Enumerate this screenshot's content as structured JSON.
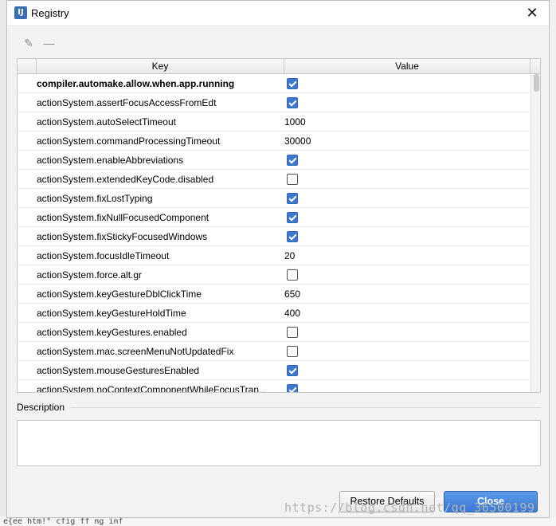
{
  "window": {
    "title": "Registry",
    "app_icon": "IJ"
  },
  "toolbar": {
    "edit_icon": "edit-icon",
    "remove_icon": "minus-icon"
  },
  "table": {
    "headers": {
      "key": "Key",
      "value": "Value"
    },
    "rows": [
      {
        "key": "compiler.automake.allow.when.app.running",
        "type": "bool",
        "checked": true,
        "bold": true
      },
      {
        "key": "actionSystem.assertFocusAccessFromEdt",
        "type": "bool",
        "checked": true
      },
      {
        "key": "actionSystem.autoSelectTimeout",
        "type": "text",
        "value": "1000"
      },
      {
        "key": "actionSystem.commandProcessingTimeout",
        "type": "text",
        "value": "30000"
      },
      {
        "key": "actionSystem.enableAbbreviations",
        "type": "bool",
        "checked": true
      },
      {
        "key": "actionSystem.extendedKeyCode.disabled",
        "type": "bool",
        "checked": false
      },
      {
        "key": "actionSystem.fixLostTyping",
        "type": "bool",
        "checked": true
      },
      {
        "key": "actionSystem.fixNullFocusedComponent",
        "type": "bool",
        "checked": true
      },
      {
        "key": "actionSystem.fixStickyFocusedWindows",
        "type": "bool",
        "checked": true
      },
      {
        "key": "actionSystem.focusIdleTimeout",
        "type": "text",
        "value": "20"
      },
      {
        "key": "actionSystem.force.alt.gr",
        "type": "bool",
        "checked": false
      },
      {
        "key": "actionSystem.keyGestureDblClickTime",
        "type": "text",
        "value": "650"
      },
      {
        "key": "actionSystem.keyGestureHoldTime",
        "type": "text",
        "value": "400"
      },
      {
        "key": "actionSystem.keyGestures.enabled",
        "type": "bool",
        "checked": false
      },
      {
        "key": "actionSystem.mac.screenMenuNotUpdatedFix",
        "type": "bool",
        "checked": false
      },
      {
        "key": "actionSystem.mouseGesturesEnabled",
        "type": "bool",
        "checked": true
      },
      {
        "key": "actionSystem.noContextComponentWhileFocusTran...",
        "type": "bool",
        "checked": true
      }
    ]
  },
  "description": {
    "label": "Description",
    "text": ""
  },
  "buttons": {
    "restore": "Restore Defaults",
    "close": "Close"
  },
  "watermark": "https://blog.csdn.net/qq_36500199",
  "background_snippet": "e{ee htm!\"  cfig ff  ng  inf"
}
